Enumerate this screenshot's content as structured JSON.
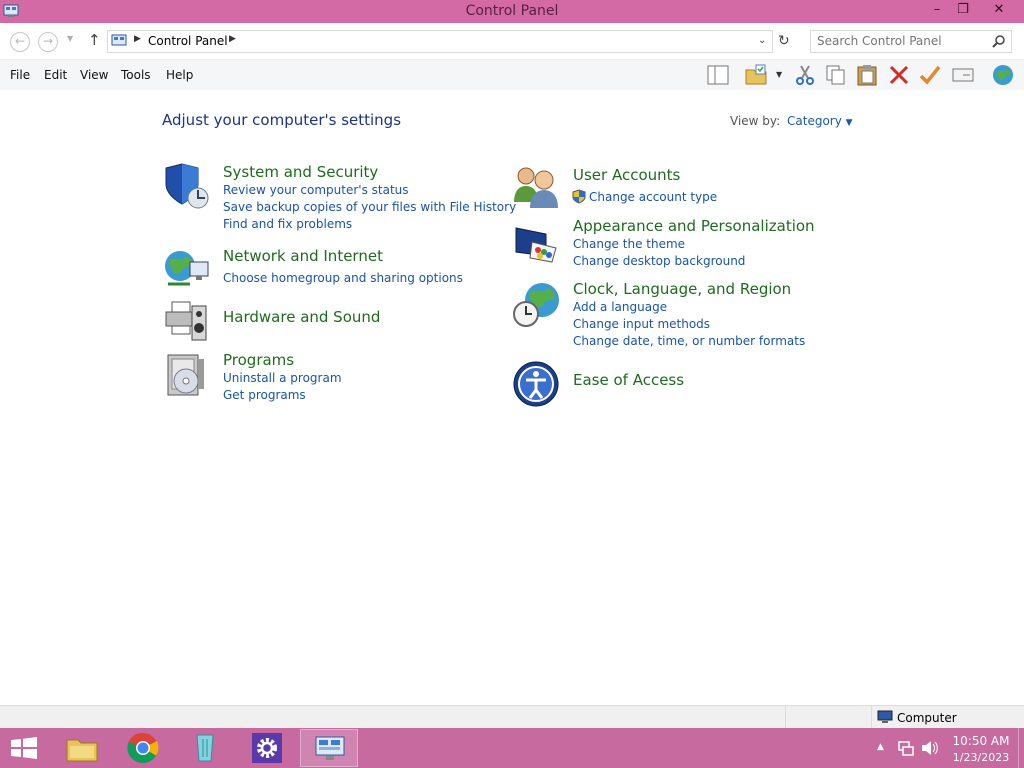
{
  "window": {
    "title": "Control Panel",
    "minimize": "–",
    "maximize": "❐",
    "close": "✕"
  },
  "address": {
    "breadcrumb": "Control Panel",
    "search_placeholder": "Search Control Panel"
  },
  "menu": {
    "file": "File",
    "edit": "Edit",
    "view": "View",
    "tools": "Tools",
    "help": "Help"
  },
  "main": {
    "heading": "Adjust your computer's settings",
    "view_by_label": "View by:",
    "view_by_value": "Category",
    "categories": [
      {
        "title": "System and Security",
        "icon": "shield-icon",
        "links": [
          "Review your computer's status",
          "Save backup copies of your files with File History",
          "Find and fix problems"
        ]
      },
      {
        "title": "Network and Internet",
        "icon": "network-globe-icon",
        "links": [
          "Choose homegroup and sharing options"
        ]
      },
      {
        "title": "Hardware and Sound",
        "icon": "printer-speaker-icon",
        "links": []
      },
      {
        "title": "Programs",
        "icon": "programs-disc-icon",
        "links": [
          "Uninstall a program",
          "Get programs"
        ]
      },
      {
        "title": "User Accounts",
        "icon": "users-icon",
        "links": [
          "Change account type"
        ]
      },
      {
        "title": "Appearance and Personalization",
        "icon": "monitor-palette-icon",
        "links": [
          "Change the theme",
          "Change desktop background"
        ]
      },
      {
        "title": "Clock, Language, and Region",
        "icon": "clock-globe-icon",
        "links": [
          "Add a language",
          "Change input methods",
          "Change date, time, or number formats"
        ]
      },
      {
        "title": "Ease of Access",
        "icon": "ease-of-access-icon",
        "links": []
      }
    ]
  },
  "statusbar": {
    "location": "Computer"
  },
  "taskbar": {
    "time": "10:50 AM",
    "date": "1/23/2023"
  },
  "colors": {
    "titlebar": "#d36aa5",
    "taskbar": "#c66aa0",
    "link": "#1a54a3",
    "category_title": "#1e6b1e",
    "heading": "#1e3287"
  }
}
